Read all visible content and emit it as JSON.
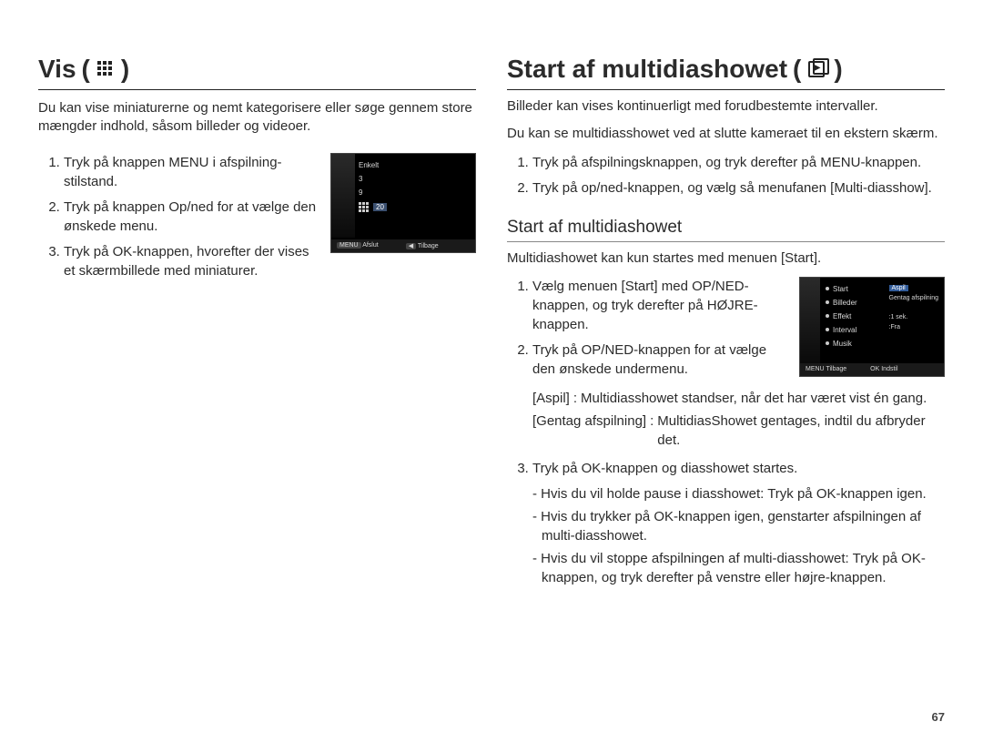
{
  "page_number": "67",
  "left": {
    "heading": "Vis",
    "intro": "Du kan vise miniaturerne og nemt kategorisere eller søge gennem store mængder indhold, såsom billeder og videoer.",
    "steps": [
      "Tryk på knappen MENU i afspilning-stilstand.",
      "Tryk på knappen Op/ned for at vælge den ønskede menu.",
      "Tryk på OK-knappen, hvorefter der vises et skærmbillede med miniaturer."
    ],
    "display": {
      "menu_top": "Enkelt",
      "menu_items": [
        "3",
        "9",
        "20"
      ],
      "footer_left_chip": "MENU",
      "footer_left": "Afslut",
      "footer_right_chip": "◀",
      "footer_right": "Tilbage"
    }
  },
  "right": {
    "heading": "Start af multidiashowet",
    "intro1": "Billeder kan vises kontinuerligt med forudbestemte intervaller.",
    "intro2": "Du kan se multidiasshowet ved at slutte kameraet til en ekstern skærm.",
    "steps_intro": [
      "Tryk på afspilningsknappen, og tryk derefter på MENU-knappen.",
      "Tryk på op/ned-knappen, og vælg så menufanen [Multi-diasshow]."
    ],
    "subheading": "Start af multidiashowet",
    "sub_intro": "Multidiashowet kan kun startes med menuen [Start].",
    "substeps": [
      "Vælg menuen [Start] med OP/NED-knappen, og tryk derefter på HØJRE-knappen.",
      "Tryk på OP/NED-knappen for at vælge den ønskede undermenu."
    ],
    "def1": {
      "term": "[Aspil]",
      "desc": "Multidiasshowet standser, når det har været vist én gang."
    },
    "def2": {
      "term": "[Gentag afspilning]",
      "desc": "MultidiasShowet gentages, indtil du afbryder det."
    },
    "step3": "Tryk på OK-knappen og diasshowet startes.",
    "notes": [
      "- Hvis du vil holde pause i diasshowet: Tryk på OK-knappen igen.",
      "- Hvis du trykker på OK-knappen igen, genstarter afspilningen af multi-diasshowet.",
      "- Hvis du vil stoppe afspilningen af multi-diasshowet: Tryk på OK-knappen, og tryk derefter på venstre eller højre-knappen."
    ],
    "display": {
      "menu": [
        "Start",
        "Billeder",
        "Effekt",
        "Interval",
        "Musik"
      ],
      "right_highlight": "Aspil",
      "right_items": [
        "Gentag afspilning",
        ":1 sek.",
        ":Fra"
      ],
      "footer_left_chip": "MENU",
      "footer_left": "Tilbage",
      "footer_right_chip": "OK",
      "footer_right": "Indstil"
    }
  }
}
